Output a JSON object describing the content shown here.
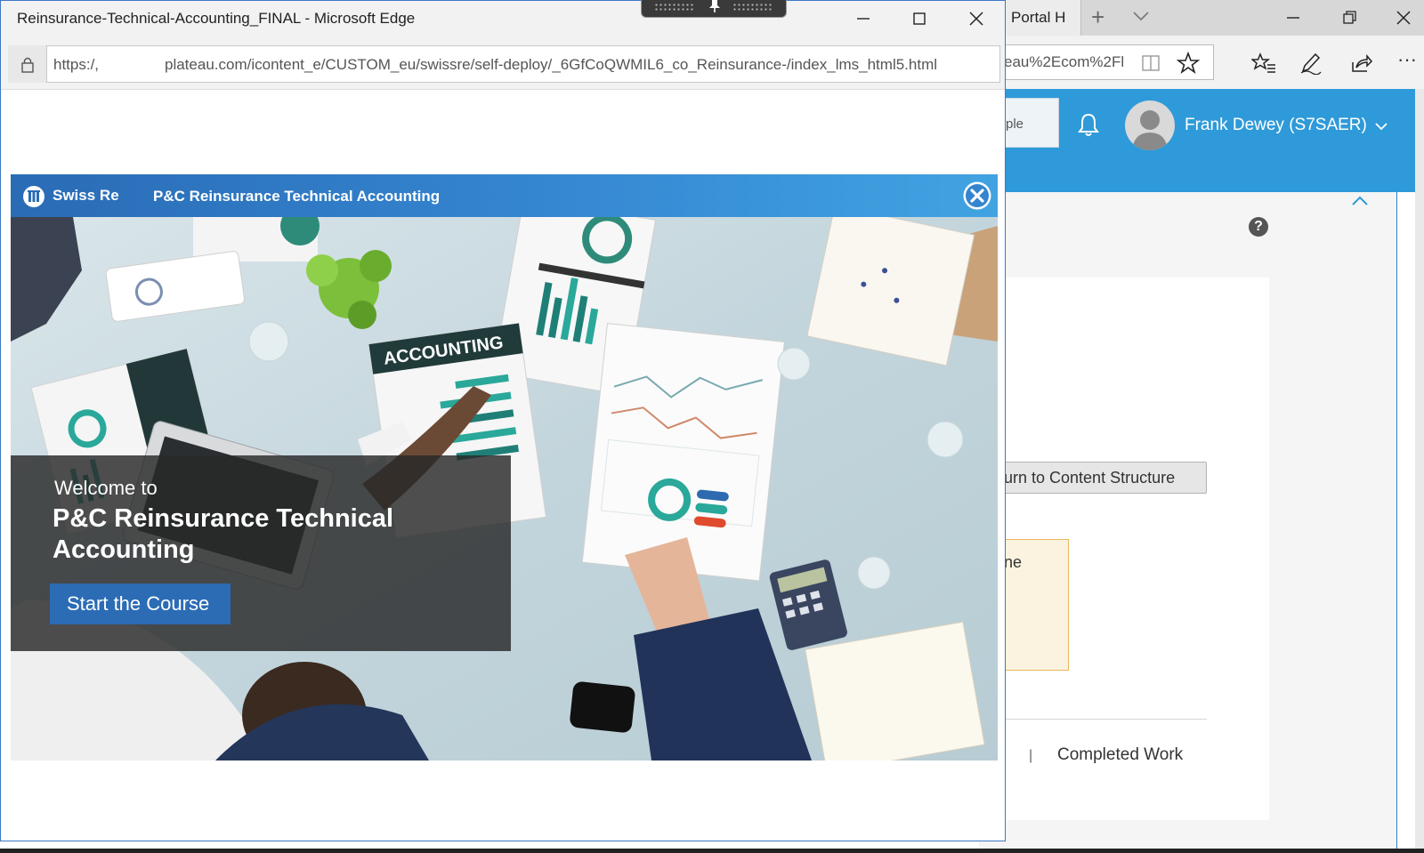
{
  "background_browser": {
    "tab_label": "Portal H",
    "url_fragment": "eau%2Ecom%2Fl",
    "more_label": "···",
    "people_label": "ple",
    "user_name": "Frank Dewey (S7SAER)",
    "help_label": "?",
    "return_label": "urn to Content Structure",
    "notice_text": "ne",
    "pipe": "|",
    "completed_link": "Completed Work",
    "accent_color": "#2f9ad9"
  },
  "popup": {
    "window_title": "Reinsurance-Technical-Accounting_FINAL - Microsoft Edge",
    "url_scheme": "https:/,",
    "url_path": "plateau.com/icontent_e/CUSTOM_eu/swissre/self-deploy/_6GfCoQWMIL6_co_Reinsurance-/index_lms_html5.html"
  },
  "course": {
    "brand": "Swiss Re",
    "title": "P&C Reinsurance Technical Accounting",
    "welcome_line": "Welcome to",
    "welcome_title": "P&C Reinsurance Technical Accounting",
    "start_label": "Start the Course",
    "hero_words": {
      "accounting": "ACCOUNTING"
    },
    "header_color": "#3484cf",
    "button_color": "#2b6cb5"
  }
}
